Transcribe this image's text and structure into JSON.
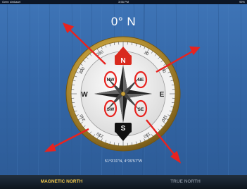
{
  "status_bar": {
    "carrier": "Geen simkaart",
    "time": "3:56 PM",
    "battery": "95%"
  },
  "heading": "0° N",
  "location": "51°9'31\"N, 4°39'57\"W",
  "compass": {
    "cardinals": {
      "north": "N",
      "east": "E",
      "south": "S",
      "west": "W"
    },
    "intercardinals": {
      "northeast": "NE",
      "northwest": "NW",
      "southeast": "SE",
      "southwest": "SW"
    },
    "degree_labels": [
      "30",
      "60",
      "120",
      "150",
      "210",
      "240",
      "300",
      "330"
    ]
  },
  "tabs": {
    "magnetic_north": "MAGNETIC NORTH",
    "true_north": "TRUE NORTH"
  },
  "colors": {
    "annotation_red": "#e8231f",
    "active_tab": "#f2c94c",
    "inactive_tab": "#7c8693",
    "gold_ring": "#c9a23c"
  }
}
